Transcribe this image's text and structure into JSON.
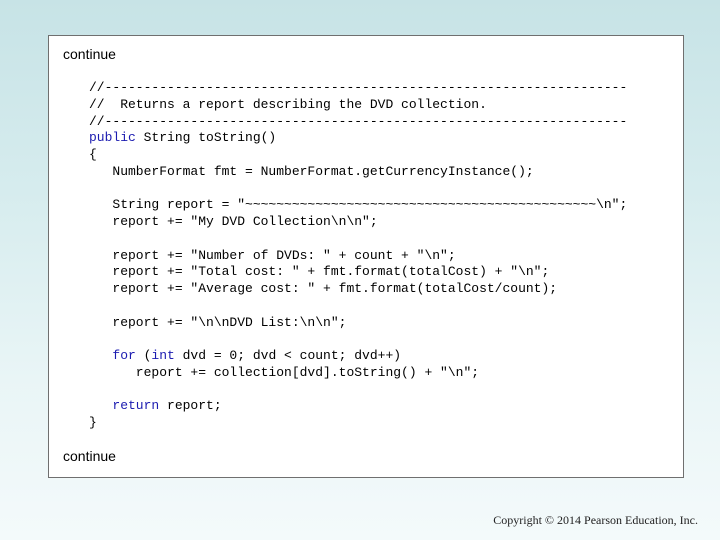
{
  "slide": {
    "continue_top": "continue",
    "continue_bottom": "continue",
    "code_lines": [
      [
        {
          "t": "//-------------------------------------------------------------------"
        }
      ],
      [
        {
          "t": "//  Returns a report describing the DVD collection."
        }
      ],
      [
        {
          "t": "//-------------------------------------------------------------------"
        }
      ],
      [
        {
          "t": "public",
          "kw": true
        },
        {
          "t": " String toString()"
        }
      ],
      [
        {
          "t": "{"
        }
      ],
      [
        {
          "t": "   NumberFormat fmt = NumberFormat.getCurrencyInstance();"
        }
      ],
      [
        {
          "t": ""
        }
      ],
      [
        {
          "t": "   String report = \"~~~~~~~~~~~~~~~~~~~~~~~~~~~~~~~~~~~~~~~~~~~~~\\n\";"
        }
      ],
      [
        {
          "t": "   report += \"My DVD Collection\\n\\n\";"
        }
      ],
      [
        {
          "t": ""
        }
      ],
      [
        {
          "t": "   report += \"Number of DVDs: \" + count + \"\\n\";"
        }
      ],
      [
        {
          "t": "   report += \"Total cost: \" + fmt.format(totalCost) + \"\\n\";"
        }
      ],
      [
        {
          "t": "   report += \"Average cost: \" + fmt.format(totalCost/count);"
        }
      ],
      [
        {
          "t": ""
        }
      ],
      [
        {
          "t": "   report += \"\\n\\nDVD List:\\n\\n\";"
        }
      ],
      [
        {
          "t": ""
        }
      ],
      [
        {
          "t": "   "
        },
        {
          "t": "for",
          "kw": true
        },
        {
          "t": " ("
        },
        {
          "t": "int",
          "kw": true
        },
        {
          "t": " dvd = 0; dvd < count; dvd++)"
        }
      ],
      [
        {
          "t": "      report += collection[dvd].toString() + \"\\n\";"
        }
      ],
      [
        {
          "t": ""
        }
      ],
      [
        {
          "t": "   "
        },
        {
          "t": "return",
          "kw": true
        },
        {
          "t": " report;"
        }
      ],
      [
        {
          "t": "}"
        }
      ]
    ]
  },
  "footer": {
    "copyright": "Copyright © 2014 Pearson Education, Inc."
  },
  "colors": {
    "keyword": "#1b1bb0",
    "background_top": "#c7e3e6",
    "panel_border": "#6f6f6f"
  }
}
